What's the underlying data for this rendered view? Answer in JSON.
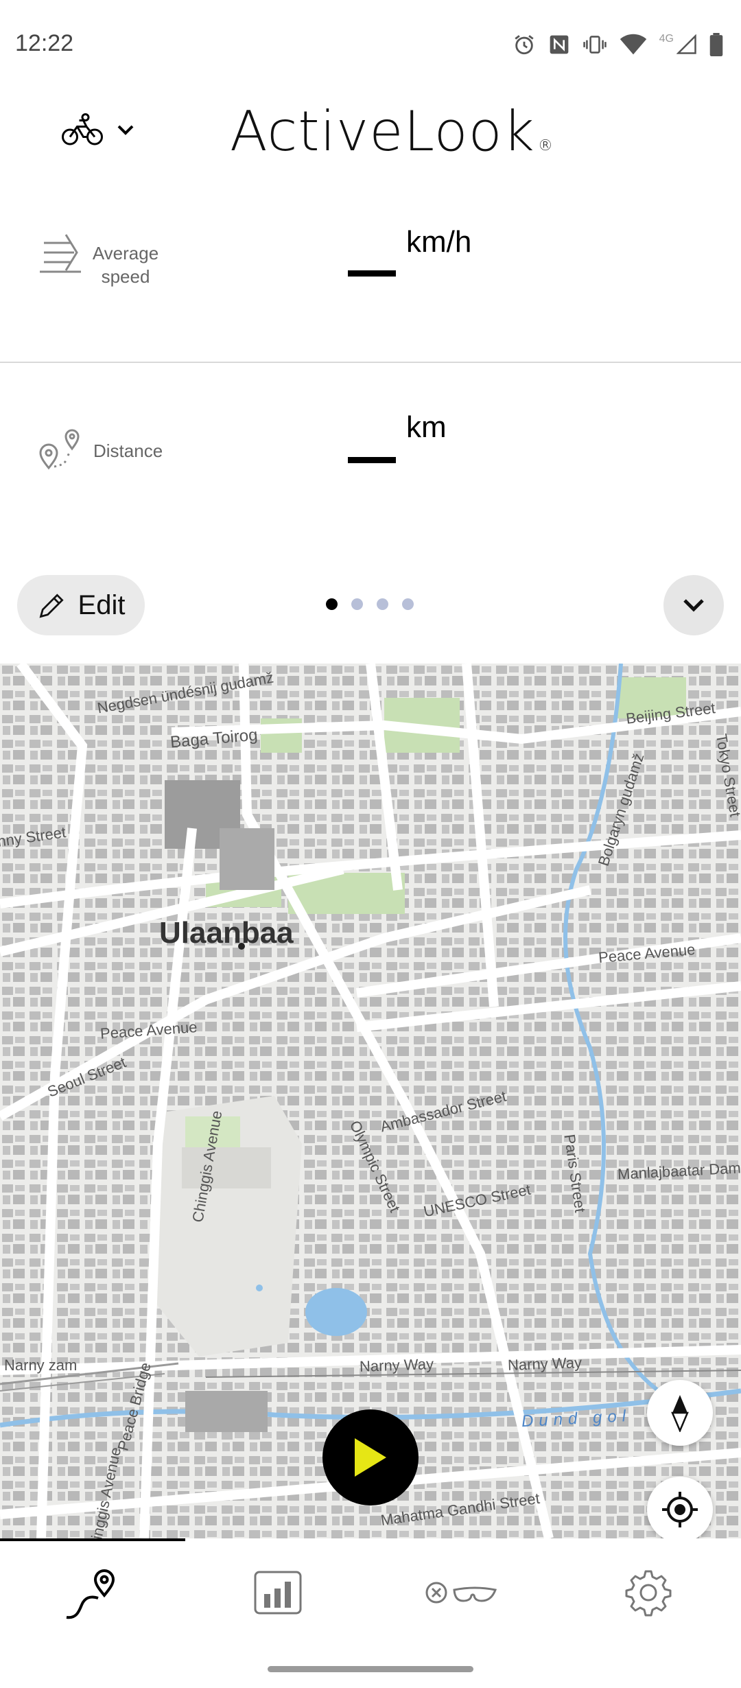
{
  "status_bar": {
    "time": "12:22",
    "icons": [
      "alarm-icon",
      "nfc-icon",
      "vibrate-icon",
      "wifi-icon",
      "4g-icon",
      "signal-icon",
      "battery-icon"
    ],
    "network": "4G"
  },
  "header": {
    "logo": "ActiveLook",
    "logo_mark": "®",
    "sport_icon": "bike-icon"
  },
  "metrics": [
    {
      "icon": "average-speed-icon",
      "label_line1": "Average",
      "label_line2": "speed",
      "value": "",
      "unit": "km/h"
    },
    {
      "icon": "distance-icon",
      "label": "Distance",
      "value": "",
      "unit": "km"
    }
  ],
  "controls": {
    "edit_label": "Edit",
    "page_count": 4,
    "active_page": 1
  },
  "map": {
    "city": "Ulaanbaa",
    "streets": [
      "Negdsen ündésnij gudamž",
      "Baga Toirog",
      "Beijing Street",
      "Tokyo Street",
      "Bolgaryn gudamž",
      "hny Street",
      "Peace Avenue",
      "Peace Avenue",
      "Seoul Street",
      "Chinggis Avenue",
      "Olympic Street",
      "Ambassador Street",
      "Paris Street",
      "Manlajbaatar Damdins",
      "UNESCO Street",
      "Narny zam",
      "Peace Bridge",
      "Narny Way",
      "Narny Way",
      "Dund gol",
      "Mahatma Gandhi Street",
      "Chinggis Avenue"
    ]
  },
  "nav": {
    "items": [
      "route-icon",
      "stats-icon",
      "glasses-icon",
      "settings-icon"
    ],
    "active": 0
  },
  "colors": {
    "accent": "#e6e615",
    "dot_inactive": "#b7bfd8",
    "river": "#8fc0e8",
    "park": "#c8e0b4"
  }
}
